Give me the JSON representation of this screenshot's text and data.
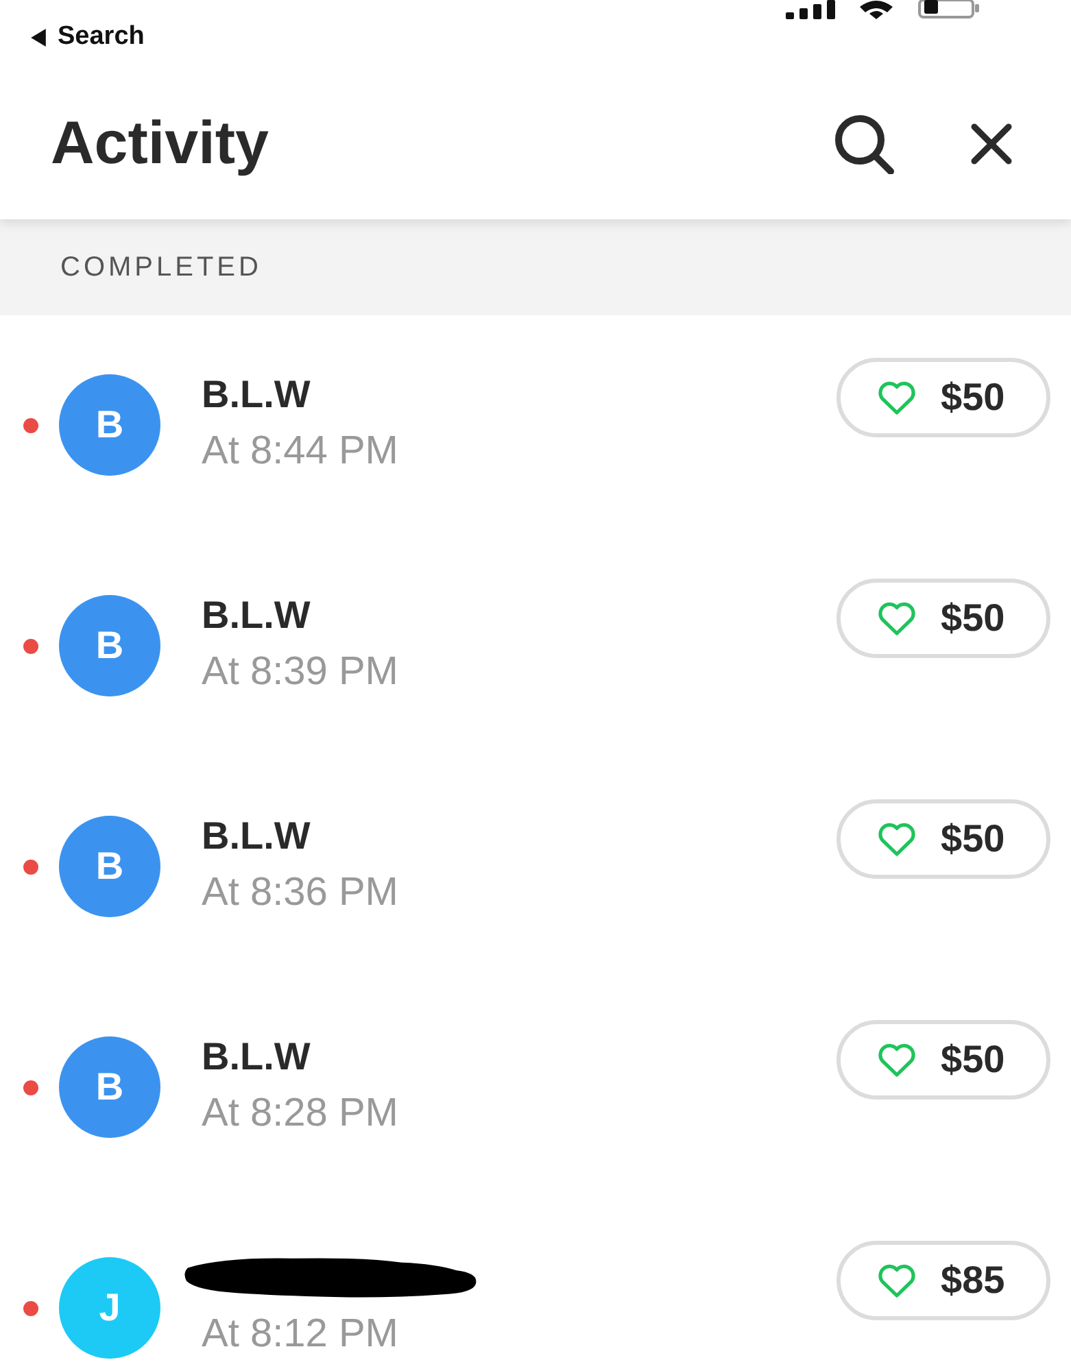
{
  "status_bar": {
    "back_label": "Search"
  },
  "header": {
    "title": "Activity"
  },
  "section": {
    "label": "COMPLETED"
  },
  "transactions": [
    {
      "avatar_letter": "B",
      "color": "#3b93ef",
      "redacted": false,
      "name": "B.L.W",
      "time": "At 8:44 PM",
      "amount": "$50",
      "unread": true
    },
    {
      "avatar_letter": "B",
      "color": "#3b93ef",
      "redacted": false,
      "name": "B.L.W",
      "time": "At 8:39 PM",
      "amount": "$50",
      "unread": true
    },
    {
      "avatar_letter": "B",
      "color": "#3b93ef",
      "redacted": false,
      "name": "B.L.W",
      "time": "At 8:36 PM",
      "amount": "$50",
      "unread": true
    },
    {
      "avatar_letter": "B",
      "color": "#3b93ef",
      "redacted": false,
      "name": "B.L.W",
      "time": "At 8:28 PM",
      "amount": "$50",
      "unread": true
    },
    {
      "avatar_letter": "J",
      "color": "#1ccaf5",
      "redacted": true,
      "time": "At 8:12 PM",
      "amount": "$85",
      "unread": true
    }
  ]
}
